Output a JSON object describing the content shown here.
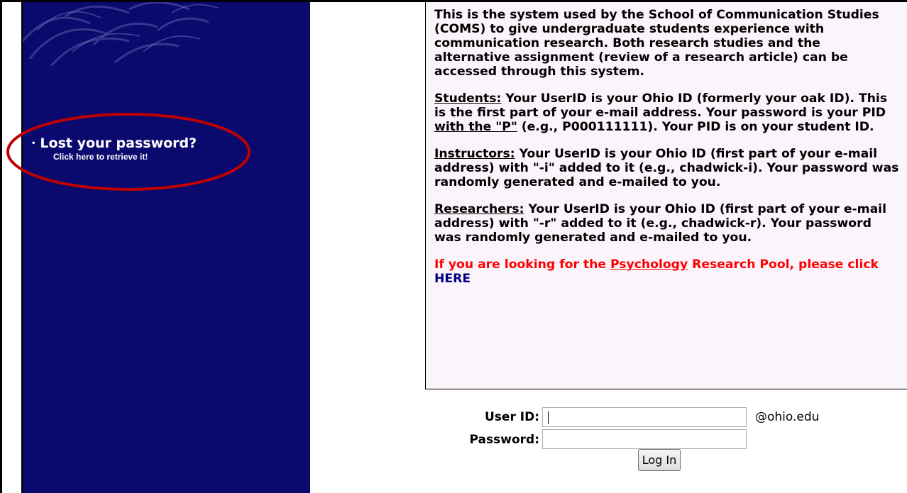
{
  "sidebar": {
    "lost_password_title": "Lost your password?",
    "lost_password_link": "Click here to retrieve it!",
    "bullet": "•",
    "background_color": "#0a0a6e",
    "highlight_circle_color": "#c00000"
  },
  "info": {
    "intro": "This is the system used by the School of Communication Studies (COMS) to give undergraduate students experience with communication research. Both research studies and the alternative assignment (review of a research article) can be accessed through this system.",
    "students_heading": "Students:",
    "students_text_1": " Your UserID is your Ohio ID (formerly your oak ID). This is the first part of your e-mail address. Your password is your PID ",
    "students_underlined": "with the \"P\"",
    "students_text_2": " (e.g., P000111111). Your PID is on your student ID.",
    "instructors_heading": "Instructors:",
    "instructors_text": " Your UserID is your Ohio ID (first part of your e-mail address) with \"-i\" added to it (e.g., chadwick-i). Your password was randomly generated and e-mailed to you.",
    "researchers_heading": "Researchers:",
    "researchers_text": " Your UserID is your Ohio ID (first part of your e-mail address) with \"-r\" added to it (e.g., chadwick-r). Your password was randomly generated and e-mailed to you.",
    "psych_text_1": "If you are looking for the ",
    "psych_link": "Psychology",
    "psych_text_2": " Research Pool, please click ",
    "psych_here": "HERE",
    "background_color": "#fbf4fb",
    "alert_color": "#ff0000"
  },
  "login": {
    "userid_label": "User ID:",
    "userid_value": "",
    "domain_suffix": "@ohio.edu",
    "password_label": "Password:",
    "password_value": "",
    "login_button": "Log In"
  }
}
